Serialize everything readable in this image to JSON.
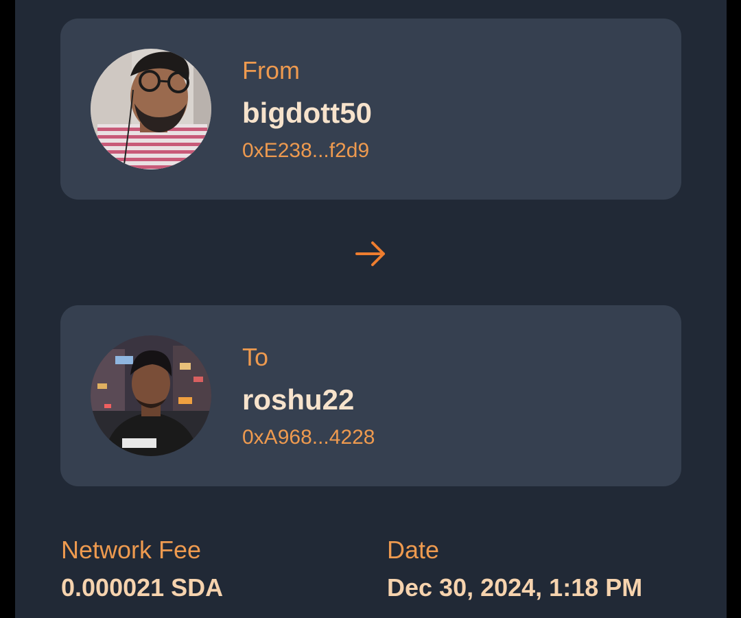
{
  "sender": {
    "label": "From",
    "username": "bigdott50",
    "address": "0xE238...f2d9"
  },
  "transfer_icon": "arrow-right-icon",
  "recipient": {
    "label": "To",
    "username": "roshu22",
    "address": "0xA968...4228"
  },
  "details": {
    "fee_label": "Network Fee",
    "fee_value": "0.000021 SDA",
    "date_label": "Date",
    "date_value": "Dec 30, 2024, 1:18 PM"
  },
  "colors": {
    "background": "#212936",
    "card": "#364050",
    "accent": "#ee9a4f",
    "name_text": "#f7e3cc"
  }
}
